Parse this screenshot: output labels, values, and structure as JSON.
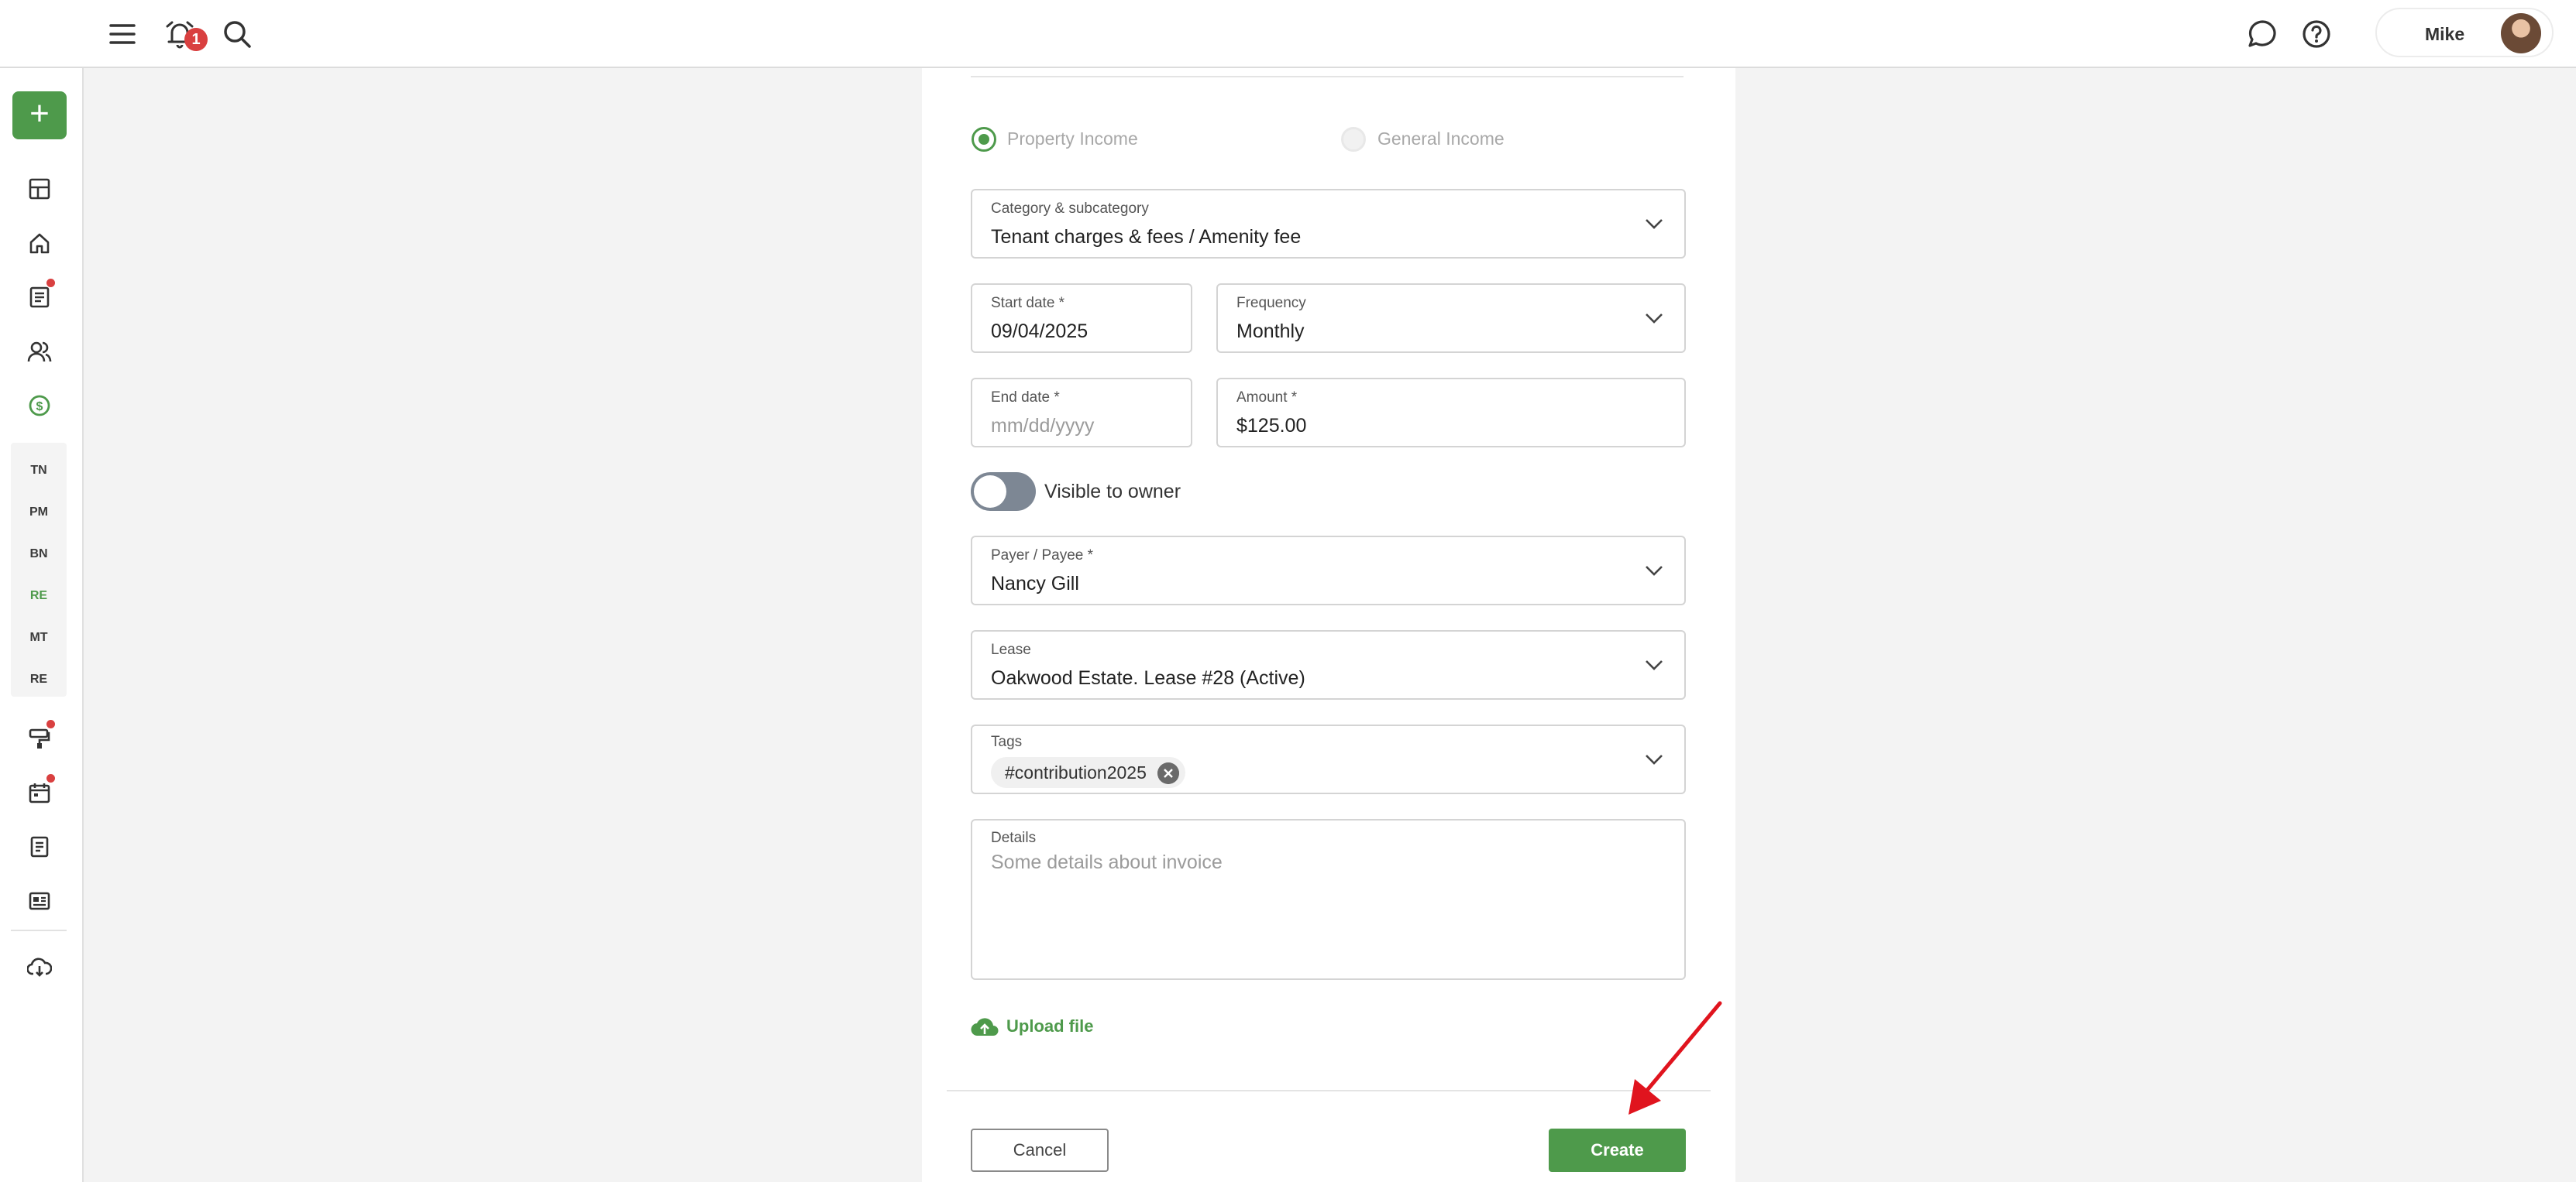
{
  "topbar": {
    "notification_count": "1",
    "user_name": "Mike"
  },
  "sidebar": {
    "add_label": "+",
    "groups": [
      "TN",
      "PM",
      "BN",
      "RE",
      "MT",
      "RE"
    ],
    "active_group_index": 3
  },
  "form": {
    "income_type": {
      "option_property": "Property Income",
      "option_general": "General Income",
      "selected": "Property Income"
    },
    "category": {
      "label": "Category & subcategory",
      "value": "Tenant charges & fees / Amenity fee"
    },
    "start_date": {
      "label": "Start date *",
      "value": "09/04/2025"
    },
    "frequency": {
      "label": "Frequency",
      "value": "Monthly"
    },
    "end_date": {
      "label": "End date *",
      "placeholder": "mm/dd/yyyy"
    },
    "amount": {
      "label": "Amount *",
      "value": "$125.00"
    },
    "visible_to_owner": {
      "label": "Visible to owner",
      "on": false
    },
    "payer": {
      "label": "Payer / Payee *",
      "value": "Nancy Gill"
    },
    "lease": {
      "label": "Lease",
      "value": "Oakwood Estate. Lease #28 (Active)"
    },
    "tags": {
      "label": "Tags",
      "items": [
        "#contribution2025"
      ]
    },
    "details": {
      "label": "Details",
      "placeholder": "Some details about invoice"
    },
    "upload_label": "Upload file",
    "cancel_label": "Cancel",
    "create_label": "Create"
  },
  "colors": {
    "accent": "#4e9a4b",
    "badge": "#d94040",
    "annotation_arrow": "#e0141e"
  },
  "icons": [
    "menu-icon",
    "notification-bell-icon",
    "search-icon",
    "chat-icon",
    "help-icon",
    "dashboard-icon",
    "home-icon",
    "document-icon",
    "people-icon",
    "dollar-icon",
    "maintenance-icon",
    "calendar-icon",
    "report-icon",
    "listing-icon",
    "download-icon",
    "chevron-down-icon",
    "remove-tag-icon",
    "upload-cloud-icon"
  ]
}
